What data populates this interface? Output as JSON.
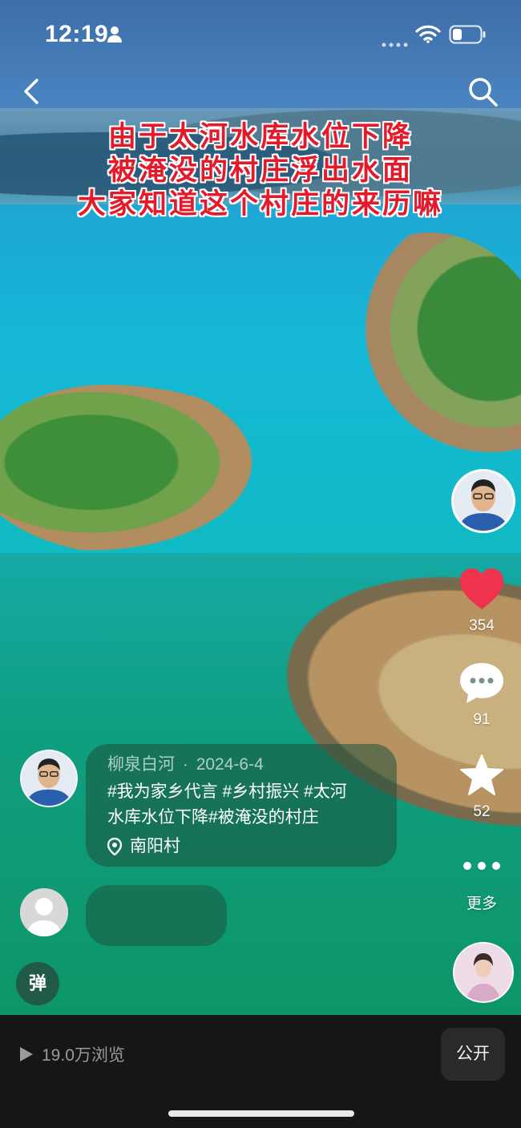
{
  "status_bar": {
    "time": "12:19",
    "icons": [
      "person-icon",
      "signal-dots-icon",
      "wifi-icon",
      "battery-icon"
    ]
  },
  "nav": {
    "icons": [
      "back-arrow-icon",
      "search-icon"
    ]
  },
  "video": {
    "caption_lines": [
      "由于太河水库水位下降",
      "被淹没的村庄浮出水面",
      "大家知道这个村庄的来历嘛"
    ]
  },
  "rail": {
    "likes": "354",
    "comments": "91",
    "favorites": "52",
    "more_label": "更多",
    "like_color": "#f0324f"
  },
  "post": {
    "author": "柳泉白河",
    "separator": "·",
    "date": "2024-6-4",
    "text_line1": "#我为家乡代言 #乡村振兴 #太河",
    "text_line2": "水库水位下降#被淹没的村庄",
    "location": "南阳村"
  },
  "danmu_label": "弹",
  "bottom": {
    "views": "19.0万浏览",
    "public_label": "公开"
  }
}
